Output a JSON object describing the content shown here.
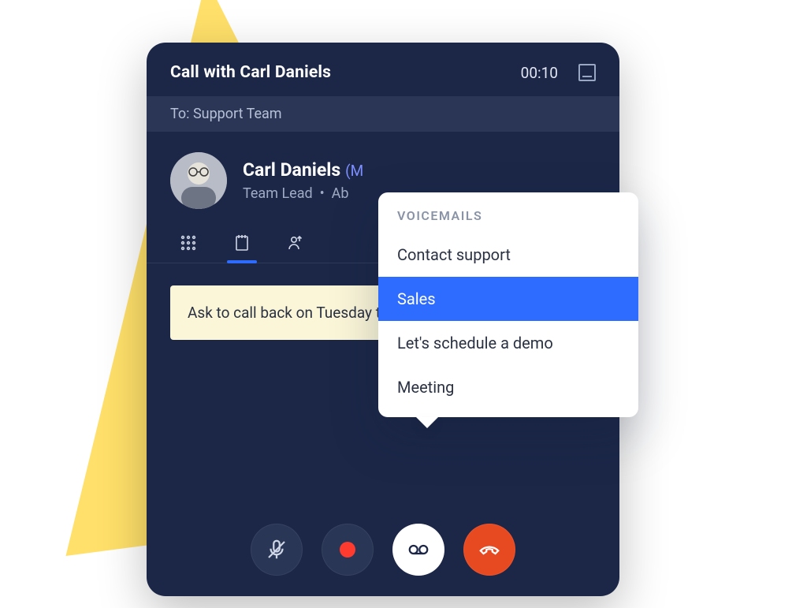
{
  "titlebar": {
    "title": "Call with Carl Daniels",
    "duration": "00:10"
  },
  "to_bar": {
    "label": "To:",
    "value": "Support Team"
  },
  "contact": {
    "name": "Carl Daniels",
    "status_prefix": "(M",
    "role": "Team Lead",
    "detail_prefix": "Ab"
  },
  "note": {
    "text": "Ask to call back on Tuesday to discuss Proposal further."
  },
  "popover": {
    "heading": "VOICEMAILS",
    "items": [
      {
        "label": "Contact support",
        "selected": false
      },
      {
        "label": "Sales",
        "selected": true
      },
      {
        "label": "Let's schedule a demo",
        "selected": false
      },
      {
        "label": "Meeting",
        "selected": false
      }
    ]
  },
  "icons": {
    "minimize": "minimize-icon",
    "keypad": "keypad-icon",
    "notes": "notes-icon",
    "transfer": "transfer-icon",
    "mute": "microphone-off-icon",
    "record": "record-icon",
    "voicemail": "voicemail-icon",
    "hangup": "phone-hangup-icon"
  },
  "colors": {
    "panel": "#1c2748",
    "accent": "#2e6cff",
    "danger": "#e74a21",
    "note_bg": "#fbf6d8",
    "shape": "#ffe06a"
  }
}
